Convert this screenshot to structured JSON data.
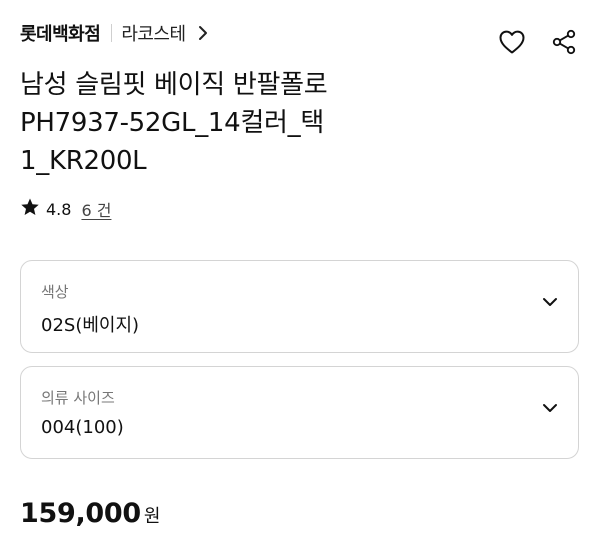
{
  "header": {
    "store_name": "롯데백화점",
    "brand_name": "라코스테"
  },
  "icons": {
    "breadcrumb_chevron": "chevron-right-icon",
    "wishlist": "heart-icon",
    "share": "share-icon",
    "rating_star": "star-icon",
    "dropdown": "chevron-down-icon"
  },
  "product": {
    "title_lines": [
      "남성 슬림핏 베이직 반팔폴로",
      "PH7937-52GL_14컬러_택",
      "1_KR200L"
    ],
    "rating": "4.8",
    "review_count": "6 건"
  },
  "options": {
    "color": {
      "label": "색상",
      "value": "02S(베이지)"
    },
    "size": {
      "label": "의류 사이즈",
      "value": "004(100)"
    }
  },
  "price": {
    "amount": "159,000",
    "unit": "원"
  }
}
